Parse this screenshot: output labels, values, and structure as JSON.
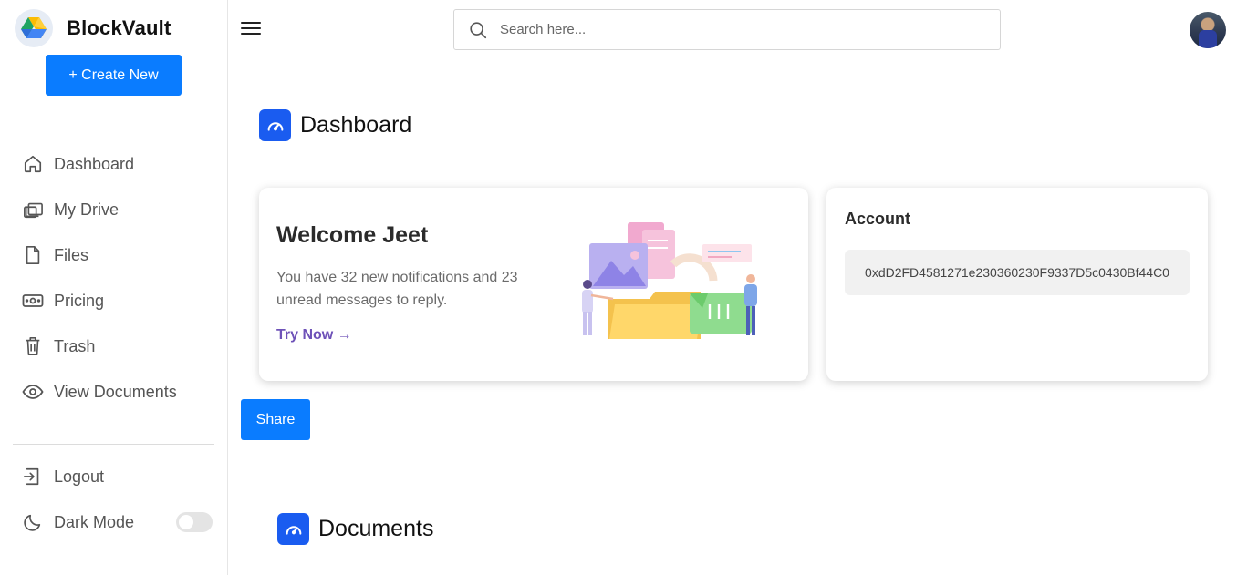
{
  "app": {
    "name": "BlockVault"
  },
  "sidebar": {
    "create_label": "+ Create New",
    "items": [
      {
        "label": "Dashboard",
        "icon": "home-icon"
      },
      {
        "label": "My Drive",
        "icon": "drive-icon"
      },
      {
        "label": "Files",
        "icon": "file-icon"
      },
      {
        "label": "Pricing",
        "icon": "money-icon"
      },
      {
        "label": "Trash",
        "icon": "trash-icon"
      },
      {
        "label": "View Documents",
        "icon": "eye-icon"
      }
    ],
    "bottom": [
      {
        "label": "Logout",
        "icon": "logout-icon"
      },
      {
        "label": "Dark Mode",
        "icon": "moon-icon",
        "toggle_on": false
      }
    ]
  },
  "header": {
    "search_placeholder": "Search here..."
  },
  "dashboard": {
    "title": "Dashboard",
    "welcome": {
      "heading": "Welcome Jeet",
      "message": "You have 32 new notifications and 23 unread messages to reply.",
      "cta": "Try Now →"
    },
    "account": {
      "heading": "Account",
      "address": "0xdD2FD4581271e230360230F9337D5c0430Bf44C0"
    },
    "share_label": "Share"
  },
  "documents": {
    "title": "Documents"
  },
  "colors": {
    "accent": "#0a7cff",
    "section_icon": "#1a5cf0",
    "cta": "#6e52b8"
  }
}
